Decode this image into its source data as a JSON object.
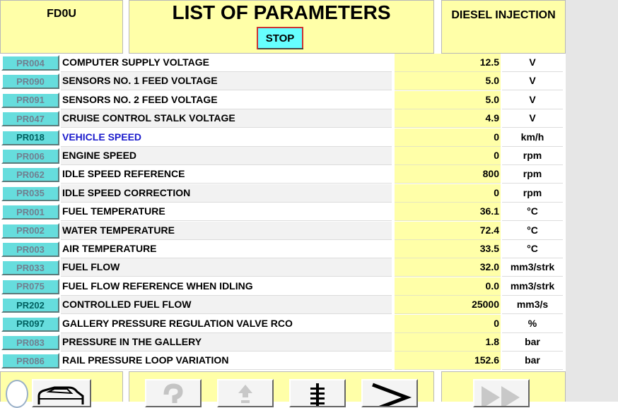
{
  "header": {
    "ecu_code": "FD0U",
    "title": "LIST OF PARAMETERS",
    "stop_label": "STOP",
    "system_name": "DIESEL INJECTION"
  },
  "parameters": [
    {
      "code": "PR004",
      "label": "COMPUTER SUPPLY VOLTAGE",
      "value": "12.5",
      "unit": "V",
      "active": false
    },
    {
      "code": "PR090",
      "label": "SENSORS NO. 1 FEED VOLTAGE",
      "value": "5.0",
      "unit": "V",
      "active": false
    },
    {
      "code": "PR091",
      "label": "SENSORS NO. 2 FEED VOLTAGE",
      "value": "5.0",
      "unit": "V",
      "active": false
    },
    {
      "code": "PR047",
      "label": "CRUISE CONTROL STALK VOLTAGE",
      "value": "4.9",
      "unit": "V",
      "active": false
    },
    {
      "code": "PR018",
      "label": "VEHICLE SPEED",
      "value": "0",
      "unit": "km/h",
      "active": true,
      "highlight": true
    },
    {
      "code": "PR006",
      "label": "ENGINE SPEED",
      "value": "0",
      "unit": "rpm",
      "active": false
    },
    {
      "code": "PR062",
      "label": "IDLE SPEED REFERENCE",
      "value": "800",
      "unit": "rpm",
      "active": false
    },
    {
      "code": "PR035",
      "label": "IDLE SPEED CORRECTION",
      "value": "0",
      "unit": "rpm",
      "active": false
    },
    {
      "code": "PR001",
      "label": "FUEL TEMPERATURE",
      "value": "36.1",
      "unit": "°C",
      "active": false
    },
    {
      "code": "PR002",
      "label": "WATER TEMPERATURE",
      "value": "72.4",
      "unit": "°C",
      "active": false
    },
    {
      "code": "PR003",
      "label": "AIR TEMPERATURE",
      "value": "33.5",
      "unit": "°C",
      "active": false
    },
    {
      "code": "PR033",
      "label": "FUEL FLOW",
      "value": "32.0",
      "unit": "mm3/strk",
      "active": false
    },
    {
      "code": "PR075",
      "label": "FUEL FLOW REFERENCE WHEN IDLING",
      "value": "0.0",
      "unit": "mm3/strk",
      "active": false
    },
    {
      "code": "PR202",
      "label": "CONTROLLED FUEL FLOW",
      "value": "25000",
      "unit": "mm3/s",
      "active": true
    },
    {
      "code": "PR097",
      "label": "GALLERY PRESSURE REGULATION VALVE RCO",
      "value": "0",
      "unit": "%",
      "active": true
    },
    {
      "code": "PR083",
      "label": "PRESSURE IN THE GALLERY",
      "value": "1.8",
      "unit": "bar",
      "active": false
    },
    {
      "code": "PR086",
      "label": "RAIL PRESSURE LOOP VARIATION",
      "value": "152.6",
      "unit": "bar",
      "active": false
    }
  ],
  "toolbar": [
    {
      "name": "vehicle-icon"
    },
    {
      "name": "help-icon"
    },
    {
      "name": "arrow-up-icon"
    },
    {
      "name": "list-icon"
    },
    {
      "name": "next-icon"
    },
    {
      "name": "fast-forward-icon"
    }
  ],
  "colors": {
    "panel_yellow": "#ffffa8",
    "code_cyan": "#66dddd",
    "stop_cyan": "#66ffff",
    "highlight_blue": "#1a1acc"
  }
}
